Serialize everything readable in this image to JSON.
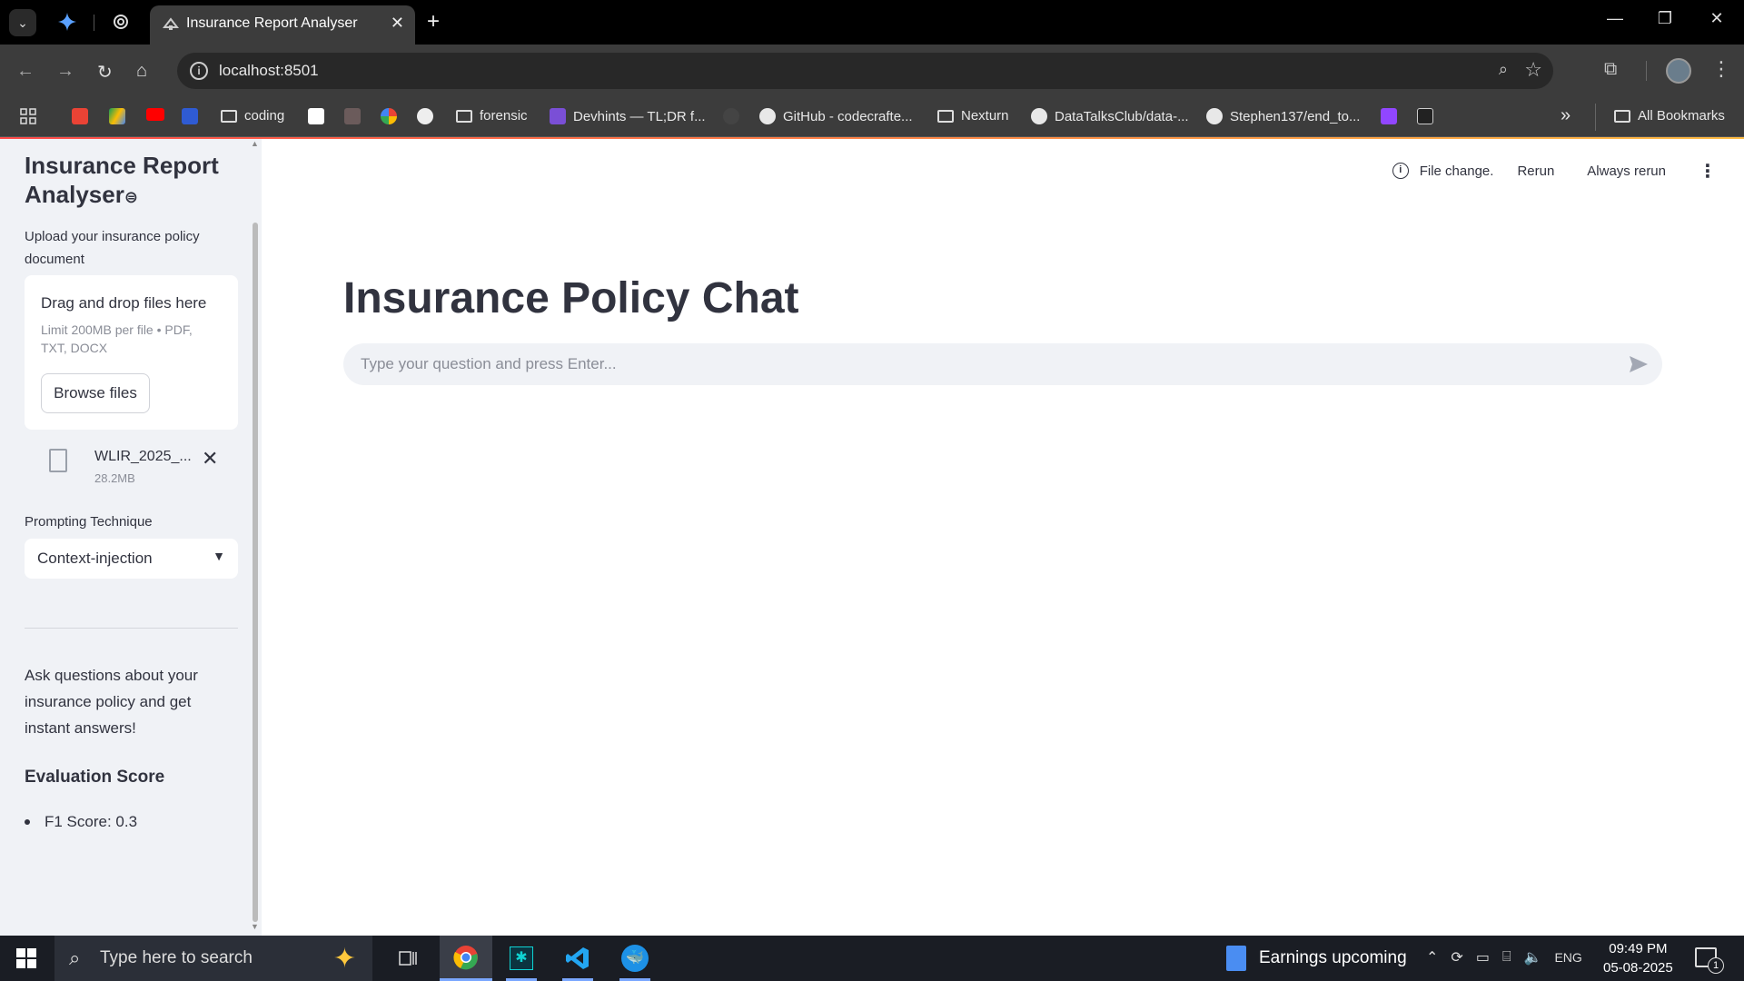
{
  "browser": {
    "tab_title": "Insurance Report Analyser",
    "url": "localhost:8501",
    "bookmarks": [
      {
        "label": "coding",
        "kind": "folder"
      },
      {
        "label": "forensic",
        "kind": "folder"
      },
      {
        "label": "Devhints — TL;DR f...",
        "kind": "site"
      },
      {
        "label": "GitHub - codecrafte...",
        "kind": "github"
      },
      {
        "label": "Nexturn",
        "kind": "folder"
      },
      {
        "label": "DataTalksClub/data-...",
        "kind": "github"
      },
      {
        "label": "Stephen137/end_to...",
        "kind": "github"
      }
    ],
    "all_bookmarks": "All Bookmarks",
    "overflow": "»"
  },
  "sidebar": {
    "title": "Insurance Report Analyser",
    "upload_label": "Upload your insurance policy document",
    "dropzone_title": "Drag and drop files here",
    "dropzone_limit": "Limit 200MB per file • PDF, TXT, DOCX",
    "browse_button": "Browse files",
    "file_name": "WLIR_2025_...",
    "file_size": "28.2MB",
    "technique_label": "Prompting Technique",
    "technique_value": "Context-injection",
    "about": "Ask questions about your insurance policy and get instant answers!",
    "eval_heading": "Evaluation Score",
    "eval_item": "F1 Score: 0.3"
  },
  "topbar": {
    "file_change": "File change.",
    "rerun": "Rerun",
    "always_rerun": "Always rerun"
  },
  "main": {
    "title": "Insurance Policy Chat",
    "chat_placeholder": "Type your question and press Enter..."
  },
  "taskbar": {
    "search_placeholder": "Type here to search",
    "news": "Earnings upcoming",
    "lang": "ENG",
    "time": "09:49 PM",
    "date": "05-08-2025",
    "notification_count": "1"
  },
  "colors": {
    "accent_gradient_start": "#ff4b4b",
    "accent_gradient_end": "#ffbd45",
    "sidebar_bg": "#f0f2f6",
    "text": "#31333f"
  }
}
